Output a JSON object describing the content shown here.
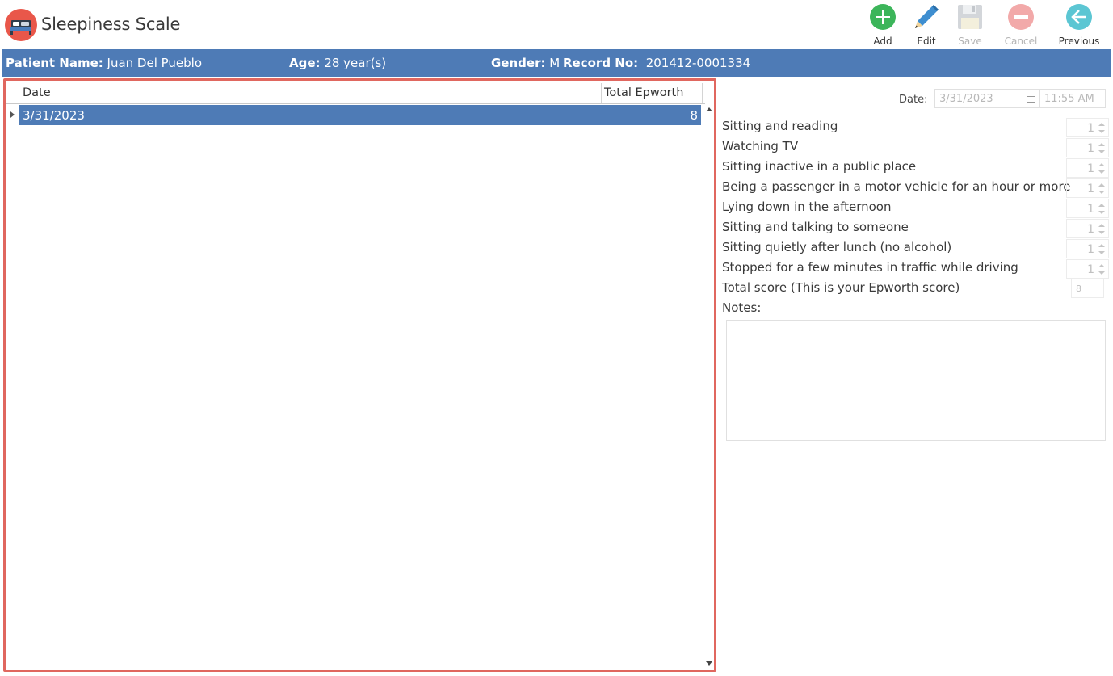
{
  "app": {
    "title": "Sleepiness Scale"
  },
  "toolbar": {
    "add": "Add",
    "edit": "Edit",
    "save": "Save",
    "cancel": "Cancel",
    "previous": "Previous"
  },
  "patient": {
    "name_label": "Patient Name:",
    "name": "Juan Del Pueblo",
    "age_label": "Age:",
    "age": "28 year(s)",
    "gender_label": "Gender:",
    "gender": "M",
    "record_label": "Record No:",
    "record": "201412-0001334"
  },
  "grid": {
    "columns": [
      "Date",
      "Total Epworth"
    ],
    "rows": [
      {
        "date": "3/31/2023",
        "total": "8"
      }
    ]
  },
  "form": {
    "date_label": "Date:",
    "date_value": "3/31/2023",
    "time_value": "11:55 AM",
    "questions": [
      {
        "label": "Sitting and reading",
        "value": "1"
      },
      {
        "label": "Watching TV",
        "value": "1"
      },
      {
        "label": "Sitting inactive in a public place",
        "value": "1"
      },
      {
        "label": "Being a passenger in a motor vehicle for an hour or more",
        "value": "1"
      },
      {
        "label": "Lying down in the afternoon",
        "value": "1"
      },
      {
        "label": "Sitting and talking to someone",
        "value": "1"
      },
      {
        "label": "Sitting quietly after lunch (no alcohol)",
        "value": "1"
      },
      {
        "label": "Stopped for a few minutes in traffic while driving",
        "value": "1"
      }
    ],
    "total_label": "Total score (This is your Epworth score)",
    "total_value": "8",
    "notes_label": "Notes:",
    "notes_value": ""
  },
  "colors": {
    "accent": "#4e7bb6",
    "highlight_border": "#e0675f",
    "add_green": "#3cb55a",
    "cancel_red": "#f2a9a9",
    "previous_teal": "#5cc6d3"
  },
  "icons": {
    "app": "bed-icon",
    "add": "plus-circle-icon",
    "edit": "pencil-icon",
    "save": "floppy-disk-icon",
    "cancel": "minus-circle-icon",
    "previous": "arrow-left-circle-icon"
  }
}
